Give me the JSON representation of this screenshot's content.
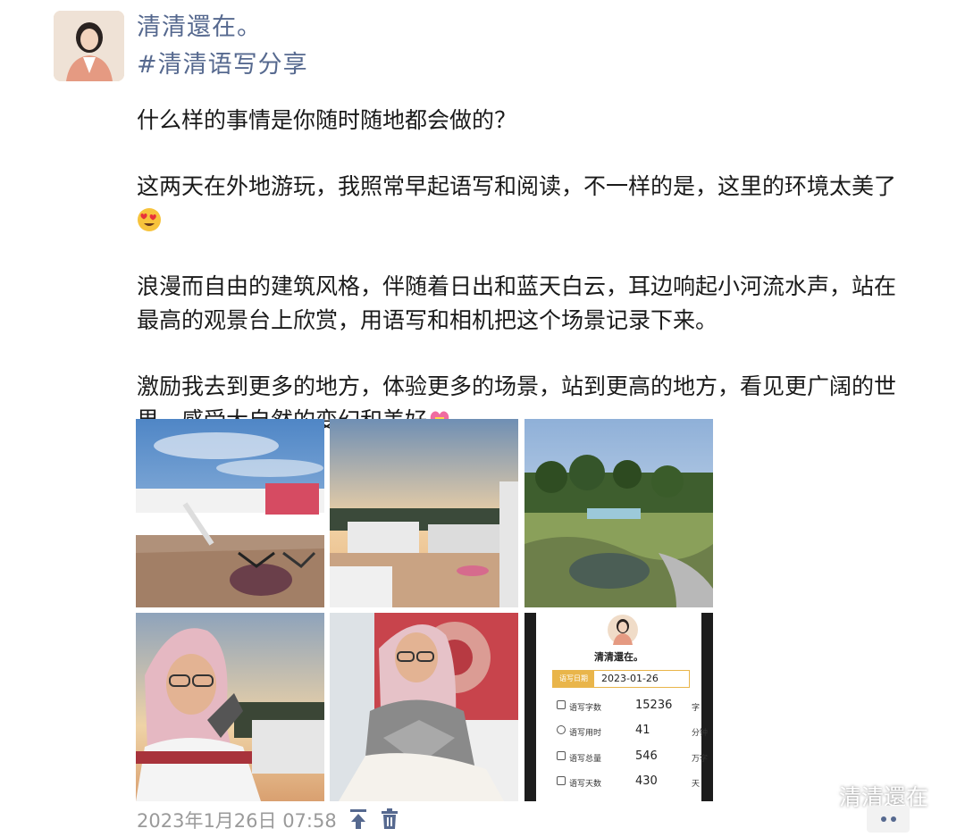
{
  "post": {
    "author": "清清還在。",
    "topic": "#清清语写分享",
    "paragraphs": [
      "什么样的事情是你随时随地都会做的？",
      "这两天在外地游玩，我照常早起语写和阅读，不一样的是，这里的环境太美了",
      "浪漫而自由的建筑风格，伴随着日出和蓝天白云，耳边响起小河流水声，站在最高的观景台上欣赏，用语写和相机把这个场景记录下来。",
      "激励我去到更多的地方，体验更多的场景，站到更高的地方，看见更广阔的世界，感受大自然的变幻和美好"
    ],
    "emojis": [
      "heart-eyes-emoji",
      "heart-ribbon-emoji"
    ],
    "timestamp": "2023年1月26日 07:58"
  },
  "photos": [
    {
      "name": "photo-rooftop-terrace"
    },
    {
      "name": "photo-sunrise-courtyard"
    },
    {
      "name": "photo-garden-pond"
    },
    {
      "name": "photo-selfie-sunrise"
    },
    {
      "name": "photo-selfie-wall"
    },
    {
      "name": "photo-stats-card"
    }
  ],
  "stats_card": {
    "name": "清清還在。",
    "date_label": "语写日期",
    "date_value": "2023-01-26",
    "rows": [
      {
        "label": "语写字数",
        "value": "15236",
        "unit": "字"
      },
      {
        "label": "语写用时",
        "value": "41",
        "unit": "分钟"
      },
      {
        "label": "语写总量",
        "value": "546",
        "unit": "万字"
      },
      {
        "label": "语写天数",
        "value": "430",
        "unit": "天"
      }
    ]
  },
  "watermark": "清清還在",
  "colors": {
    "link": "#56698f",
    "timestamp": "#9a9a9a",
    "accent_gold": "#e9b54a"
  },
  "icons": [
    "pin-top-icon",
    "trash-icon",
    "more-icon",
    "wechat-icon"
  ]
}
